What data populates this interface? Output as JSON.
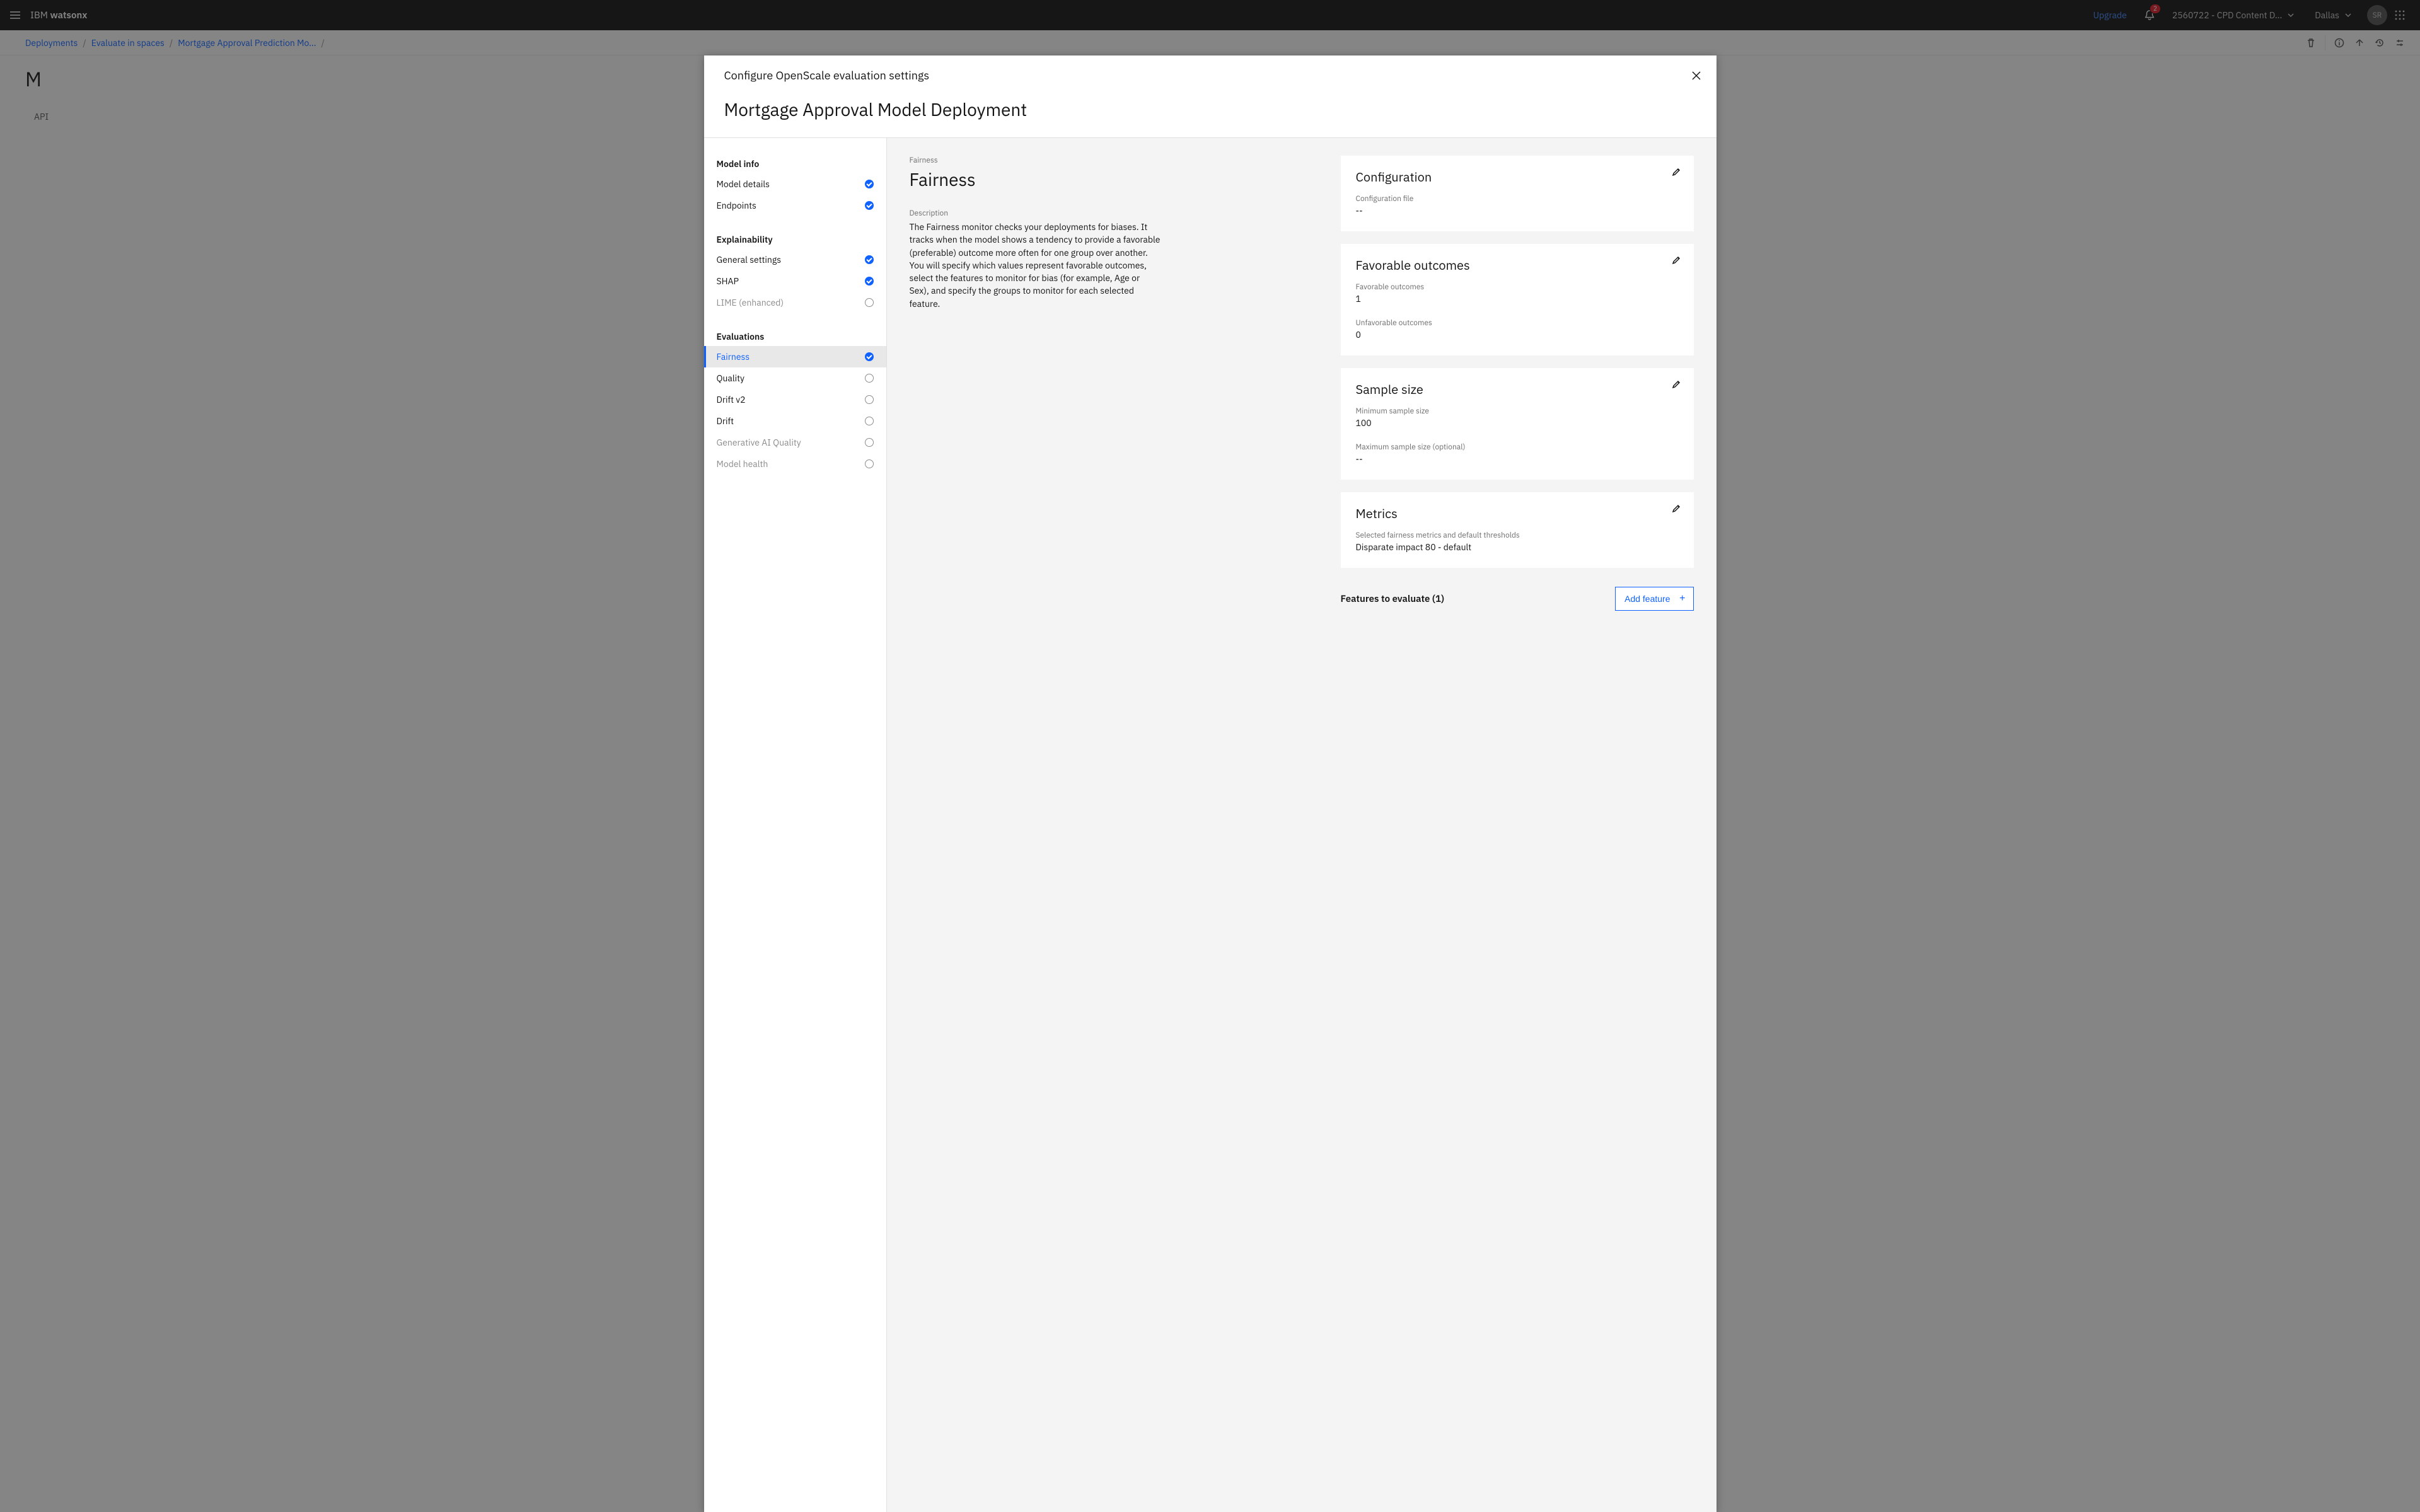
{
  "header": {
    "brand_light": "IBM ",
    "brand_bold": "watsonx",
    "upgrade": "Upgrade",
    "notif_count": "2",
    "project": "2560722 - CPD Content D...",
    "region": "Dallas",
    "avatar": "SR"
  },
  "breadcrumb": {
    "items": [
      "Deployments",
      "Evaluate in spaces",
      "Mortgage Approval Prediction Mo..."
    ],
    "tail_sep": " / "
  },
  "page": {
    "title_initial": "M",
    "tab_api": "API"
  },
  "modal": {
    "title": "Configure OpenScale evaluation settings",
    "subtitle": "Mortgage Approval Model Deployment",
    "sidebar": {
      "groups": [
        {
          "title": "Model info",
          "items": [
            {
              "label": "Model details",
              "state": "done"
            },
            {
              "label": "Endpoints",
              "state": "done"
            }
          ]
        },
        {
          "title": "Explainability",
          "items": [
            {
              "label": "General settings",
              "state": "done"
            },
            {
              "label": "SHAP",
              "state": "done"
            },
            {
              "label": "LIME (enhanced)",
              "state": "todo",
              "dim": true
            }
          ]
        },
        {
          "title": "Evaluations",
          "items": [
            {
              "label": "Fairness",
              "state": "done",
              "active": true
            },
            {
              "label": "Quality",
              "state": "todo"
            },
            {
              "label": "Drift v2",
              "state": "todo"
            },
            {
              "label": "Drift",
              "state": "todo"
            },
            {
              "label": "Generative AI Quality",
              "state": "todo",
              "dim": true
            },
            {
              "label": "Model health",
              "state": "todo",
              "dim": true
            }
          ]
        }
      ]
    },
    "main": {
      "eyebrow": "Fairness",
      "heading": "Fairness",
      "desc_label": "Description",
      "description": "The Fairness monitor checks your deployments for biases. It tracks when the model shows a tendency to provide a favorable (preferable) outcome more often for one group over another. You will specify which values represent favorable outcomes, select the features to monitor for bias (for example, Age or Sex), and specify the groups to monitor for each selected feature."
    },
    "cards": {
      "config": {
        "title": "Configuration",
        "file_label": "Configuration file",
        "file_value": "--"
      },
      "fav": {
        "title": "Favorable outcomes",
        "fav_label": "Favorable outcomes",
        "fav_value": "1",
        "unfav_label": "Unfavorable outcomes",
        "unfav_value": "0"
      },
      "sample": {
        "title": "Sample size",
        "min_label": "Minimum sample size",
        "min_value": "100",
        "max_label": "Maximum sample size (optional)",
        "max_value": "--"
      },
      "metrics": {
        "title": "Metrics",
        "sel_label": "Selected fairness metrics and default thresholds",
        "sel_value": "Disparate impact 80 - default"
      },
      "features": {
        "title": "Features to evaluate (1)",
        "add_label": "Add feature"
      }
    }
  }
}
